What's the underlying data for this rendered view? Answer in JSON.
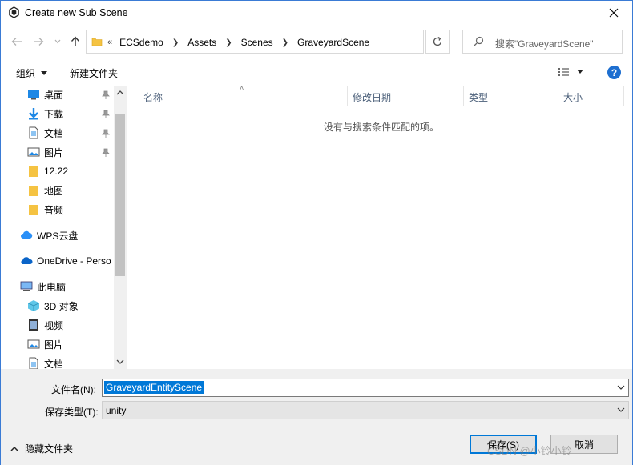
{
  "window": {
    "title": "Create new Sub Scene",
    "close_icon": "close-icon"
  },
  "address": {
    "overflow_symbol": "«",
    "crumbs": [
      "ECSdemo",
      "Assets",
      "Scenes",
      "GraveyardScene"
    ],
    "search_placeholder": "搜索\"GraveyardScene\""
  },
  "toolbar": {
    "organize_label": "组织",
    "new_folder_label": "新建文件夹",
    "help_label": "?"
  },
  "nav": {
    "quick_access": [
      {
        "label": "桌面",
        "icon": "desktop-icon",
        "pinned": true
      },
      {
        "label": "下载",
        "icon": "download-icon",
        "pinned": true
      },
      {
        "label": "文档",
        "icon": "document-icon",
        "pinned": true
      },
      {
        "label": "图片",
        "icon": "picture-icon",
        "pinned": true
      },
      {
        "label": "12.22",
        "icon": "folder-icon",
        "pinned": false
      },
      {
        "label": "地图",
        "icon": "folder-icon",
        "pinned": false
      },
      {
        "label": "音频",
        "icon": "folder-icon",
        "pinned": false
      }
    ],
    "wps": "WPS云盘",
    "onedrive": "OneDrive - Perso",
    "this_pc": "此电脑",
    "pc_items": [
      {
        "label": "3D 对象",
        "icon": "3d-objects-icon"
      },
      {
        "label": "视频",
        "icon": "video-icon"
      },
      {
        "label": "图片",
        "icon": "picture-icon"
      },
      {
        "label": "文档",
        "icon": "document-icon"
      }
    ]
  },
  "columns": [
    "名称",
    "修改日期",
    "类型",
    "大小"
  ],
  "empty_message": "没有与搜索条件匹配的项。",
  "form": {
    "filename_label": "文件名(N):",
    "filename_value": "GraveyardEntityScene",
    "filetype_label": "保存类型(T):",
    "filetype_value": "unity",
    "hide_folders_label": "隐藏文件夹",
    "save_label": "保存(S)",
    "cancel_label": "取消"
  },
  "watermark": "CSDN @小铃小铃",
  "colors": {
    "accent": "#0078d7",
    "folder": "#f5c342",
    "help": "#1e6fd0"
  }
}
